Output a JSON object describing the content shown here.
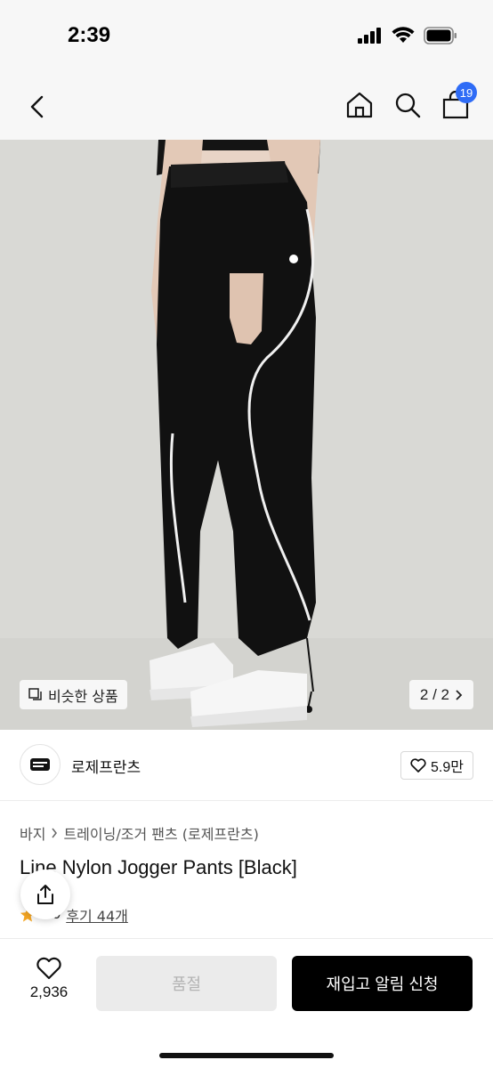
{
  "status_bar": {
    "time": "2:39"
  },
  "nav": {
    "cart_count": "19",
    "icons": [
      "back-icon",
      "home-icon",
      "search-icon",
      "cart-icon"
    ]
  },
  "image": {
    "similar_label": "비슷한 상품",
    "pager": "2 / 2",
    "colors": {
      "background": "#dadad6",
      "pants": "#111111",
      "piping": "#f2f2f2"
    }
  },
  "brand": {
    "name": "로제프란츠",
    "likes": "5.9만"
  },
  "product": {
    "breadcrumb": [
      "바지",
      "트레이닝/조거 팬츠 (로제프란츠)"
    ],
    "title": "Line Nylon Jogger Pants [Black]",
    "rating": "4.9",
    "reviews": "후기 44개"
  },
  "bottom": {
    "wish_count": "2,936",
    "soldout_label": "품절",
    "restock_label": "재입고 알림 신청"
  },
  "colors": {
    "badge": "#2f6cf6",
    "star": "#f5a623",
    "primary_button": "#000000",
    "disabled_button": "#ebebeb"
  }
}
